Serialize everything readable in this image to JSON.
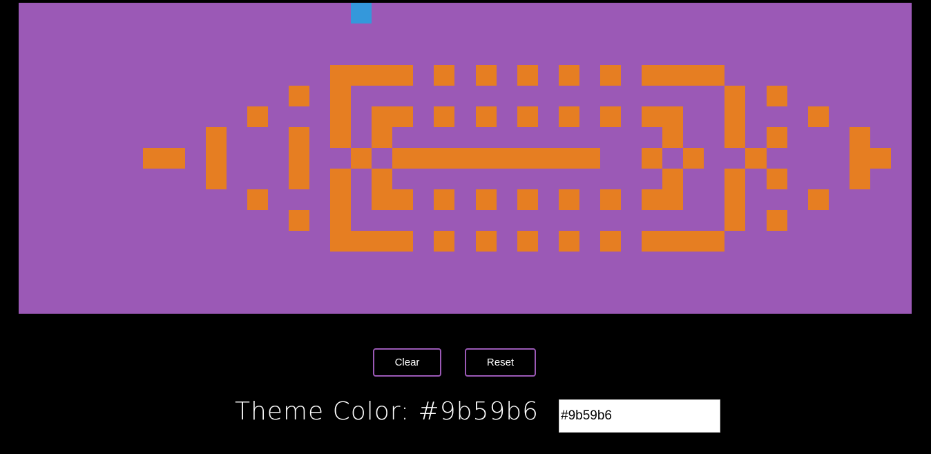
{
  "colors": {
    "theme": "#9b59b6",
    "cell_on": "#e67e22",
    "cursor": "#3498db",
    "background": "#000000"
  },
  "grid": {
    "cols": 43,
    "rows": 15,
    "pattern": [
      "...........................................",
      "...........................................",
      "...........................................",
      "...............####.#.#.#.#.#.####.........",
      ".............#.#..................#.#......",
      "...........#...#.##.#.#.#.#.#.##..#...#....",
      ".........#...#.#.#.............#..#.#...#..",
      "......##.#...#..#.##########..#.#..#....##.",
      ".........#...#.#.#.............#..#.#...#..",
      "...........#...#.##.#.#.#.#.#.##..#...#....",
      ".............#.#..................#.#......",
      "...............####.#.#.#.#.#.####.........",
      "...........................................",
      "...........................................",
      "..........................................."
    ],
    "cursor_cell": [
      16,
      0
    ]
  },
  "controls": {
    "clear_label": "Clear",
    "reset_label": "Reset",
    "theme_label": "Theme Color: #9b59b6",
    "theme_value": "#9b59b6"
  }
}
